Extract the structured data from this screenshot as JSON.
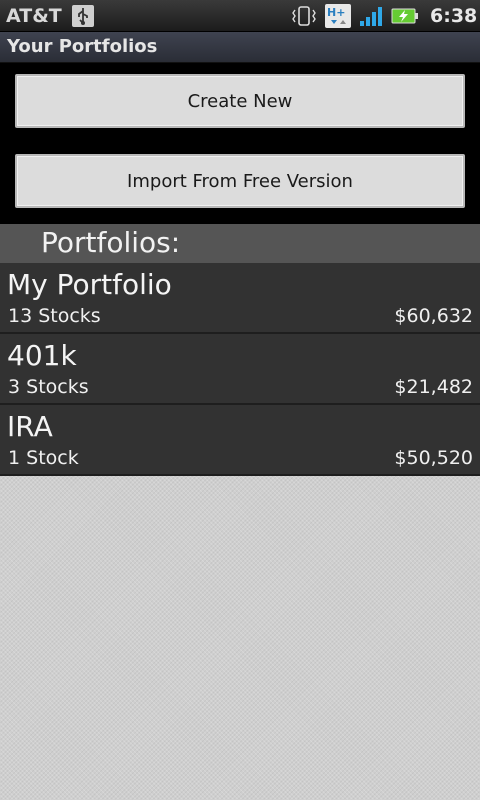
{
  "status_bar": {
    "carrier": "AT&T",
    "time": "6:38",
    "icons": [
      "usb-icon",
      "vibrate-icon",
      "hspa-plus-icon",
      "signal-icon",
      "battery-charging-icon"
    ],
    "battery_color": "#66cc33",
    "signal_color": "#2fa8e8"
  },
  "title_bar": {
    "title": "Your Portfolios"
  },
  "buttons": {
    "create_new": "Create New",
    "import_free": "Import From Free Version"
  },
  "portfolios_header": "Portfolios:",
  "portfolios": [
    {
      "name": "My Portfolio",
      "stocks": "13 Stocks",
      "value": "$60,632"
    },
    {
      "name": "401k",
      "stocks": "3 Stocks",
      "value": "$21,482"
    },
    {
      "name": "IRA",
      "stocks": "1 Stock",
      "value": "$50,520"
    }
  ]
}
